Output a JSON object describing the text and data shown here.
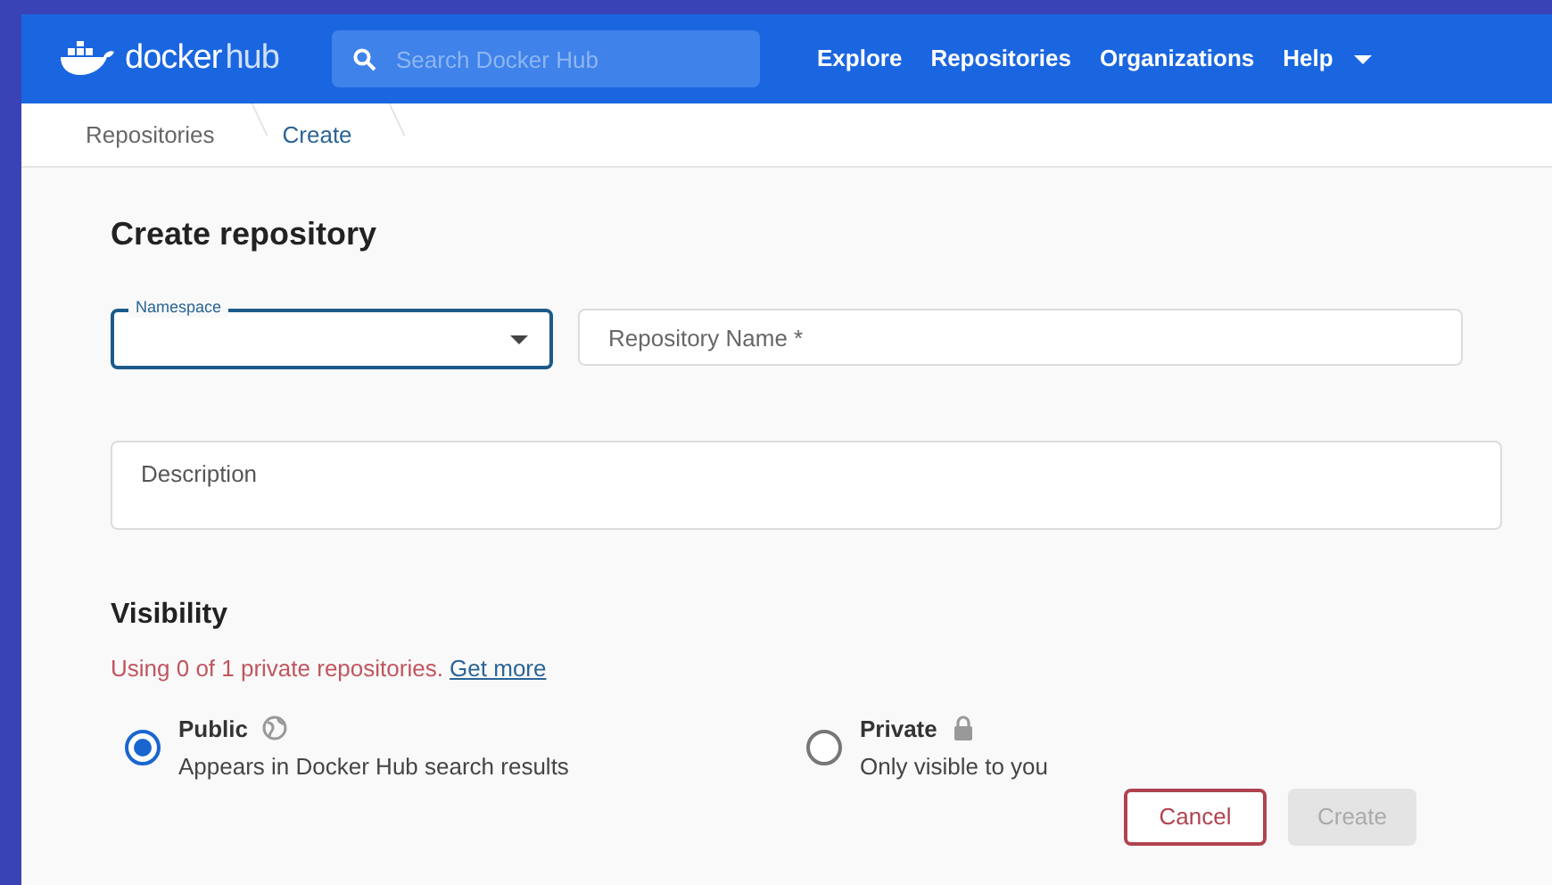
{
  "header": {
    "logo": "docker",
    "logo_suffix": "hub",
    "search": {
      "placeholder": "Search Docker Hub"
    },
    "nav": [
      {
        "label": "Explore"
      },
      {
        "label": "Repositories"
      },
      {
        "label": "Organizations"
      },
      {
        "label": "Help",
        "dropdown": true
      }
    ]
  },
  "breadcrumb": [
    {
      "label": "Repositories",
      "selected": false
    },
    {
      "label": "Create",
      "selected": true
    }
  ],
  "form": {
    "title": "Create repository",
    "namespace": {
      "label": "Namespace",
      "focused": true
    },
    "repository_name": {
      "placeholder": "Repository Name *"
    },
    "description": {
      "placeholder": "Description"
    },
    "visibility": {
      "title": "Visibility",
      "usage": "Using 0 of 1 private repositories.",
      "link": "Get more",
      "options": [
        {
          "kind": "public",
          "label": "Public",
          "description": "Appears in Docker Hub search results",
          "selected": true
        },
        {
          "kind": "private",
          "label": "Private",
          "description": "Only visible to you",
          "selected": false
        }
      ]
    },
    "buttons": [
      {
        "label": "Cancel",
        "disabled": false
      },
      {
        "label": "Create",
        "disabled": true
      }
    ]
  }
}
